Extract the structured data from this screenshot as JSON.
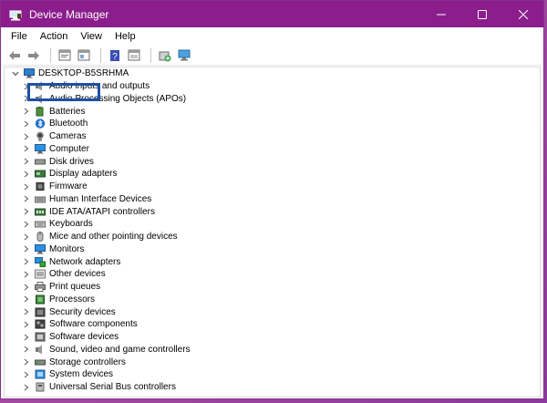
{
  "window": {
    "title": "Device Manager",
    "accent": "#8b1d8d",
    "controls": {
      "minimize": "minimize-icon",
      "maximize": "maximize-icon",
      "close": "close-icon"
    }
  },
  "menu": [
    "File",
    "Action",
    "View",
    "Help"
  ],
  "toolbar": [
    "back-arrow-icon",
    "forward-arrow-icon",
    "properties-icon",
    "show-hidden-icon",
    "help-icon",
    "update-driver-icon",
    "add-legacy-hardware-icon",
    "scan-hardware-icon"
  ],
  "tree": {
    "root": "DESKTOP-B5SRHMA",
    "items": [
      {
        "label": "Audio inputs and outputs",
        "icon": "speaker-icon"
      },
      {
        "label": "Audio Processing Objects (APOs)",
        "icon": "speaker-icon"
      },
      {
        "label": "Batteries",
        "icon": "battery-icon"
      },
      {
        "label": "Bluetooth",
        "icon": "bluetooth-icon"
      },
      {
        "label": "Cameras",
        "icon": "camera-icon"
      },
      {
        "label": "Computer",
        "icon": "monitor-icon"
      },
      {
        "label": "Disk drives",
        "icon": "disk-drive-icon"
      },
      {
        "label": "Display adapters",
        "icon": "display-adapter-icon"
      },
      {
        "label": "Firmware",
        "icon": "chip-icon"
      },
      {
        "label": "Human Interface Devices",
        "icon": "hid-icon"
      },
      {
        "label": "IDE ATA/ATAPI controllers",
        "icon": "ide-controller-icon"
      },
      {
        "label": "Keyboards",
        "icon": "keyboard-icon"
      },
      {
        "label": "Mice and other pointing devices",
        "icon": "mouse-icon"
      },
      {
        "label": "Monitors",
        "icon": "monitor-icon"
      },
      {
        "label": "Network adapters",
        "icon": "network-icon"
      },
      {
        "label": "Other devices",
        "icon": "unknown-device-icon"
      },
      {
        "label": "Print queues",
        "icon": "printer-icon"
      },
      {
        "label": "Processors",
        "icon": "processor-icon"
      },
      {
        "label": "Security devices",
        "icon": "security-icon"
      },
      {
        "label": "Software components",
        "icon": "software-component-icon"
      },
      {
        "label": "Software devices",
        "icon": "software-device-icon"
      },
      {
        "label": "Sound, video and game controllers",
        "icon": "speaker-icon"
      },
      {
        "label": "Storage controllers",
        "icon": "storage-controller-icon"
      },
      {
        "label": "System devices",
        "icon": "system-device-icon"
      },
      {
        "label": "Universal Serial Bus controllers",
        "icon": "usb-icon"
      }
    ],
    "highlighted": "Disk drives",
    "highlight_color": "#1f4fa8"
  }
}
